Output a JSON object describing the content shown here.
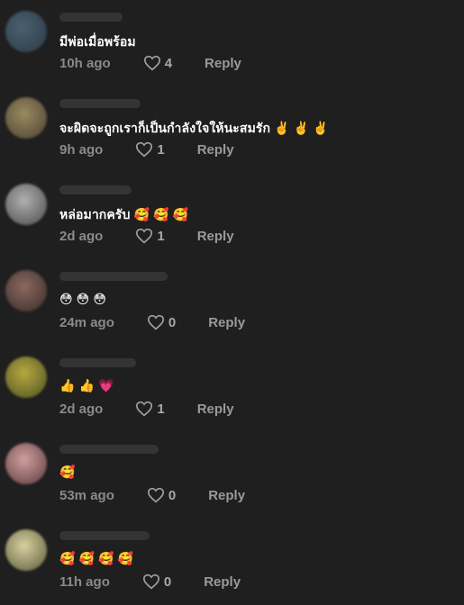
{
  "comments": [
    {
      "text": "มีพ่อเมื่อพร้อม",
      "time": "10h ago",
      "likes": "4",
      "reply": "Reply",
      "avatar_color": "#3b4d5a"
    },
    {
      "text": "จะผิดจะถูกเราก็เป็นกำลังใจให้นะสมรัก ✌️ ✌️ ✌️",
      "time": "9h ago",
      "likes": "1",
      "reply": "Reply",
      "avatar_color": "#6e6450"
    },
    {
      "text": "หล่อมากครับ 🥰 🥰 🥰",
      "time": "2d ago",
      "likes": "1",
      "reply": "Reply",
      "avatar_color": "#5c5c5c"
    },
    {
      "text": "😳 😳 😳",
      "time": "24m ago",
      "likes": "0",
      "reply": "Reply",
      "avatar_color": "#5a4a45"
    },
    {
      "text": "👍 👍 💗",
      "time": "2d ago",
      "likes": "1",
      "reply": "Reply",
      "avatar_color": "#7a7a2a"
    },
    {
      "text": "🥰",
      "time": "53m ago",
      "likes": "0",
      "reply": "Reply",
      "avatar_color": "#8a5a5a"
    },
    {
      "text": "🥰 🥰 🥰 🥰",
      "time": "11h ago",
      "likes": "0",
      "reply": "Reply",
      "avatar_color": "#7a7a50"
    }
  ]
}
